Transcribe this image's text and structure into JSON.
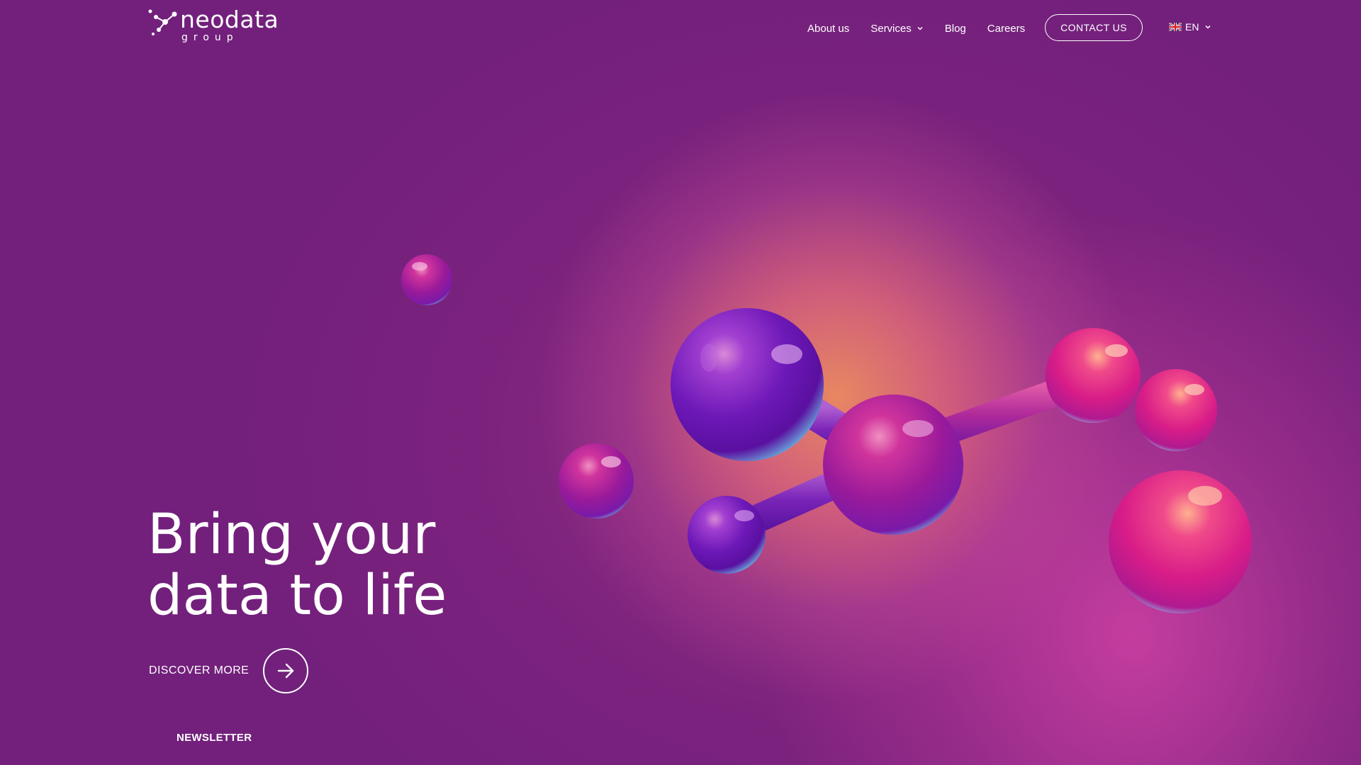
{
  "brand": {
    "name": "neodata",
    "sub": "group"
  },
  "nav": {
    "items": [
      {
        "label": "About us",
        "has_dropdown": false
      },
      {
        "label": "Services",
        "has_dropdown": true
      },
      {
        "label": "Blog",
        "has_dropdown": false
      },
      {
        "label": "Careers",
        "has_dropdown": false
      }
    ],
    "contact_label": "CONTACT US",
    "language": {
      "code": "EN",
      "icon": "uk-flag-icon"
    }
  },
  "hero": {
    "line1": "Bring your",
    "line2": "data to life",
    "cta_label": "DISCOVER MORE",
    "cta_icon": "arrow-right-icon"
  },
  "footer": {
    "newsletter_label": "NEWSLETTER"
  },
  "colors": {
    "background": "#72207c",
    "glow": "#ec8c60",
    "sphere_purple": "#7a1fc0",
    "sphere_pink": "#e0207a",
    "text": "#ffffff"
  }
}
